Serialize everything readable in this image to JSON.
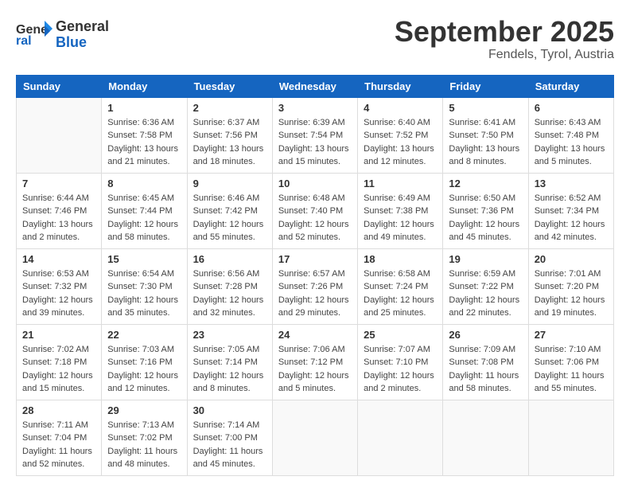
{
  "header": {
    "logo_line1": "General",
    "logo_line2": "Blue",
    "month": "September 2025",
    "location": "Fendels, Tyrol, Austria"
  },
  "days_of_week": [
    "Sunday",
    "Monday",
    "Tuesday",
    "Wednesday",
    "Thursday",
    "Friday",
    "Saturday"
  ],
  "weeks": [
    [
      {
        "day": "",
        "info": ""
      },
      {
        "day": "1",
        "info": "Sunrise: 6:36 AM\nSunset: 7:58 PM\nDaylight: 13 hours\nand 21 minutes."
      },
      {
        "day": "2",
        "info": "Sunrise: 6:37 AM\nSunset: 7:56 PM\nDaylight: 13 hours\nand 18 minutes."
      },
      {
        "day": "3",
        "info": "Sunrise: 6:39 AM\nSunset: 7:54 PM\nDaylight: 13 hours\nand 15 minutes."
      },
      {
        "day": "4",
        "info": "Sunrise: 6:40 AM\nSunset: 7:52 PM\nDaylight: 13 hours\nand 12 minutes."
      },
      {
        "day": "5",
        "info": "Sunrise: 6:41 AM\nSunset: 7:50 PM\nDaylight: 13 hours\nand 8 minutes."
      },
      {
        "day": "6",
        "info": "Sunrise: 6:43 AM\nSunset: 7:48 PM\nDaylight: 13 hours\nand 5 minutes."
      }
    ],
    [
      {
        "day": "7",
        "info": "Sunrise: 6:44 AM\nSunset: 7:46 PM\nDaylight: 13 hours\nand 2 minutes."
      },
      {
        "day": "8",
        "info": "Sunrise: 6:45 AM\nSunset: 7:44 PM\nDaylight: 12 hours\nand 58 minutes."
      },
      {
        "day": "9",
        "info": "Sunrise: 6:46 AM\nSunset: 7:42 PM\nDaylight: 12 hours\nand 55 minutes."
      },
      {
        "day": "10",
        "info": "Sunrise: 6:48 AM\nSunset: 7:40 PM\nDaylight: 12 hours\nand 52 minutes."
      },
      {
        "day": "11",
        "info": "Sunrise: 6:49 AM\nSunset: 7:38 PM\nDaylight: 12 hours\nand 49 minutes."
      },
      {
        "day": "12",
        "info": "Sunrise: 6:50 AM\nSunset: 7:36 PM\nDaylight: 12 hours\nand 45 minutes."
      },
      {
        "day": "13",
        "info": "Sunrise: 6:52 AM\nSunset: 7:34 PM\nDaylight: 12 hours\nand 42 minutes."
      }
    ],
    [
      {
        "day": "14",
        "info": "Sunrise: 6:53 AM\nSunset: 7:32 PM\nDaylight: 12 hours\nand 39 minutes."
      },
      {
        "day": "15",
        "info": "Sunrise: 6:54 AM\nSunset: 7:30 PM\nDaylight: 12 hours\nand 35 minutes."
      },
      {
        "day": "16",
        "info": "Sunrise: 6:56 AM\nSunset: 7:28 PM\nDaylight: 12 hours\nand 32 minutes."
      },
      {
        "day": "17",
        "info": "Sunrise: 6:57 AM\nSunset: 7:26 PM\nDaylight: 12 hours\nand 29 minutes."
      },
      {
        "day": "18",
        "info": "Sunrise: 6:58 AM\nSunset: 7:24 PM\nDaylight: 12 hours\nand 25 minutes."
      },
      {
        "day": "19",
        "info": "Sunrise: 6:59 AM\nSunset: 7:22 PM\nDaylight: 12 hours\nand 22 minutes."
      },
      {
        "day": "20",
        "info": "Sunrise: 7:01 AM\nSunset: 7:20 PM\nDaylight: 12 hours\nand 19 minutes."
      }
    ],
    [
      {
        "day": "21",
        "info": "Sunrise: 7:02 AM\nSunset: 7:18 PM\nDaylight: 12 hours\nand 15 minutes."
      },
      {
        "day": "22",
        "info": "Sunrise: 7:03 AM\nSunset: 7:16 PM\nDaylight: 12 hours\nand 12 minutes."
      },
      {
        "day": "23",
        "info": "Sunrise: 7:05 AM\nSunset: 7:14 PM\nDaylight: 12 hours\nand 8 minutes."
      },
      {
        "day": "24",
        "info": "Sunrise: 7:06 AM\nSunset: 7:12 PM\nDaylight: 12 hours\nand 5 minutes."
      },
      {
        "day": "25",
        "info": "Sunrise: 7:07 AM\nSunset: 7:10 PM\nDaylight: 12 hours\nand 2 minutes."
      },
      {
        "day": "26",
        "info": "Sunrise: 7:09 AM\nSunset: 7:08 PM\nDaylight: 11 hours\nand 58 minutes."
      },
      {
        "day": "27",
        "info": "Sunrise: 7:10 AM\nSunset: 7:06 PM\nDaylight: 11 hours\nand 55 minutes."
      }
    ],
    [
      {
        "day": "28",
        "info": "Sunrise: 7:11 AM\nSunset: 7:04 PM\nDaylight: 11 hours\nand 52 minutes."
      },
      {
        "day": "29",
        "info": "Sunrise: 7:13 AM\nSunset: 7:02 PM\nDaylight: 11 hours\nand 48 minutes."
      },
      {
        "day": "30",
        "info": "Sunrise: 7:14 AM\nSunset: 7:00 PM\nDaylight: 11 hours\nand 45 minutes."
      },
      {
        "day": "",
        "info": ""
      },
      {
        "day": "",
        "info": ""
      },
      {
        "day": "",
        "info": ""
      },
      {
        "day": "",
        "info": ""
      }
    ]
  ]
}
